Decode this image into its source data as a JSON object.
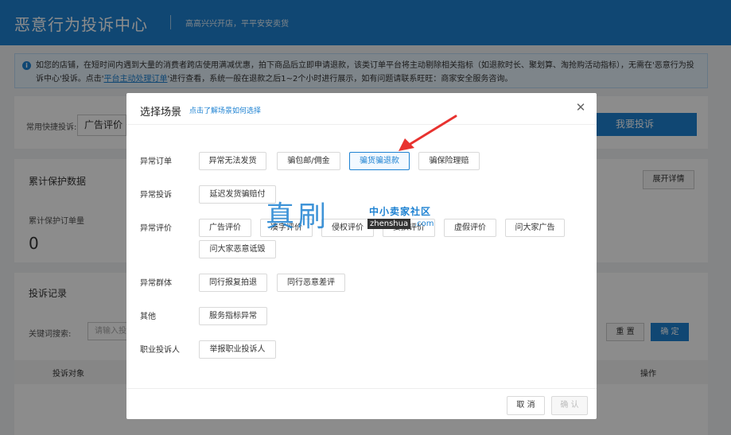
{
  "header": {
    "title": "恶意行为投诉中心",
    "slogan": "高高兴兴开店，平平安安卖货"
  },
  "notice": {
    "text_before": "如您的店铺，在短时间内遇到大量的消费者跨店使用满减优惠，拍下商品后立即申请退款，该类订单平台将主动剔除相关指标（如退款时长、聚划算、淘抢购活动指标），无需在'恶意行为投诉中心'投诉。点击'",
    "link": "平台主动处理订单",
    "text_after": "'进行查看，系统一般在退款之后1~2个小时进行展示，如有问题请联系旺旺：商家安全服务咨询。"
  },
  "background": {
    "quick_label": "常用快捷投诉:",
    "quick_value": "广告评价",
    "complain_button": "我要投诉",
    "protect_title": "累计保护数据",
    "expand_button": "展开详情",
    "protect_orders_label": "累计保护订单量",
    "protect_orders_value": "0",
    "records_title": "投诉记录",
    "keyword_label": "关键词搜索:",
    "keyword_placeholder": "请输入投",
    "reset_button": "重 置",
    "confirm_button": "确 定",
    "col_target": "投诉对象",
    "col_action": "操作"
  },
  "modal": {
    "title": "选择场景",
    "help_link": "点击了解场景如何选择",
    "categories": [
      {
        "label": "异常订单",
        "options": [
          "异常无法发货",
          "骗包邮/佣金",
          "骗货骗退款",
          "骗保险理赔"
        ]
      },
      {
        "label": "异常投诉",
        "options": [
          "延迟发货骗赔付"
        ]
      },
      {
        "label": "异常评价",
        "options": [
          "广告评价",
          "凑字评价",
          "侵权评价",
          "要挟评价",
          "虚假评价",
          "问大家广告",
          "问大家恶意诋毁"
        ]
      },
      {
        "label": "异常群体",
        "options": [
          "同行报复拍退",
          "同行恶意差评"
        ]
      },
      {
        "label": "其他",
        "options": [
          "服务指标异常"
        ]
      },
      {
        "label": "职业投诉人",
        "options": [
          "举报职业投诉人"
        ]
      }
    ],
    "selected_option": "骗货骗退款",
    "cancel_button": "取 消",
    "confirm_button": "确 认"
  },
  "watermark": {
    "big": "真刷",
    "small": "中小卖家社区",
    "domain_box": "zhenshua",
    "domain_suffix": ".com"
  },
  "colors": {
    "brand": "#1e82d2",
    "selected_border": "#1e82d2",
    "arrow": "#e8322f"
  },
  "icons": {
    "notice": "info-icon",
    "close": "close-icon",
    "pointer": "arrow-annotation"
  }
}
